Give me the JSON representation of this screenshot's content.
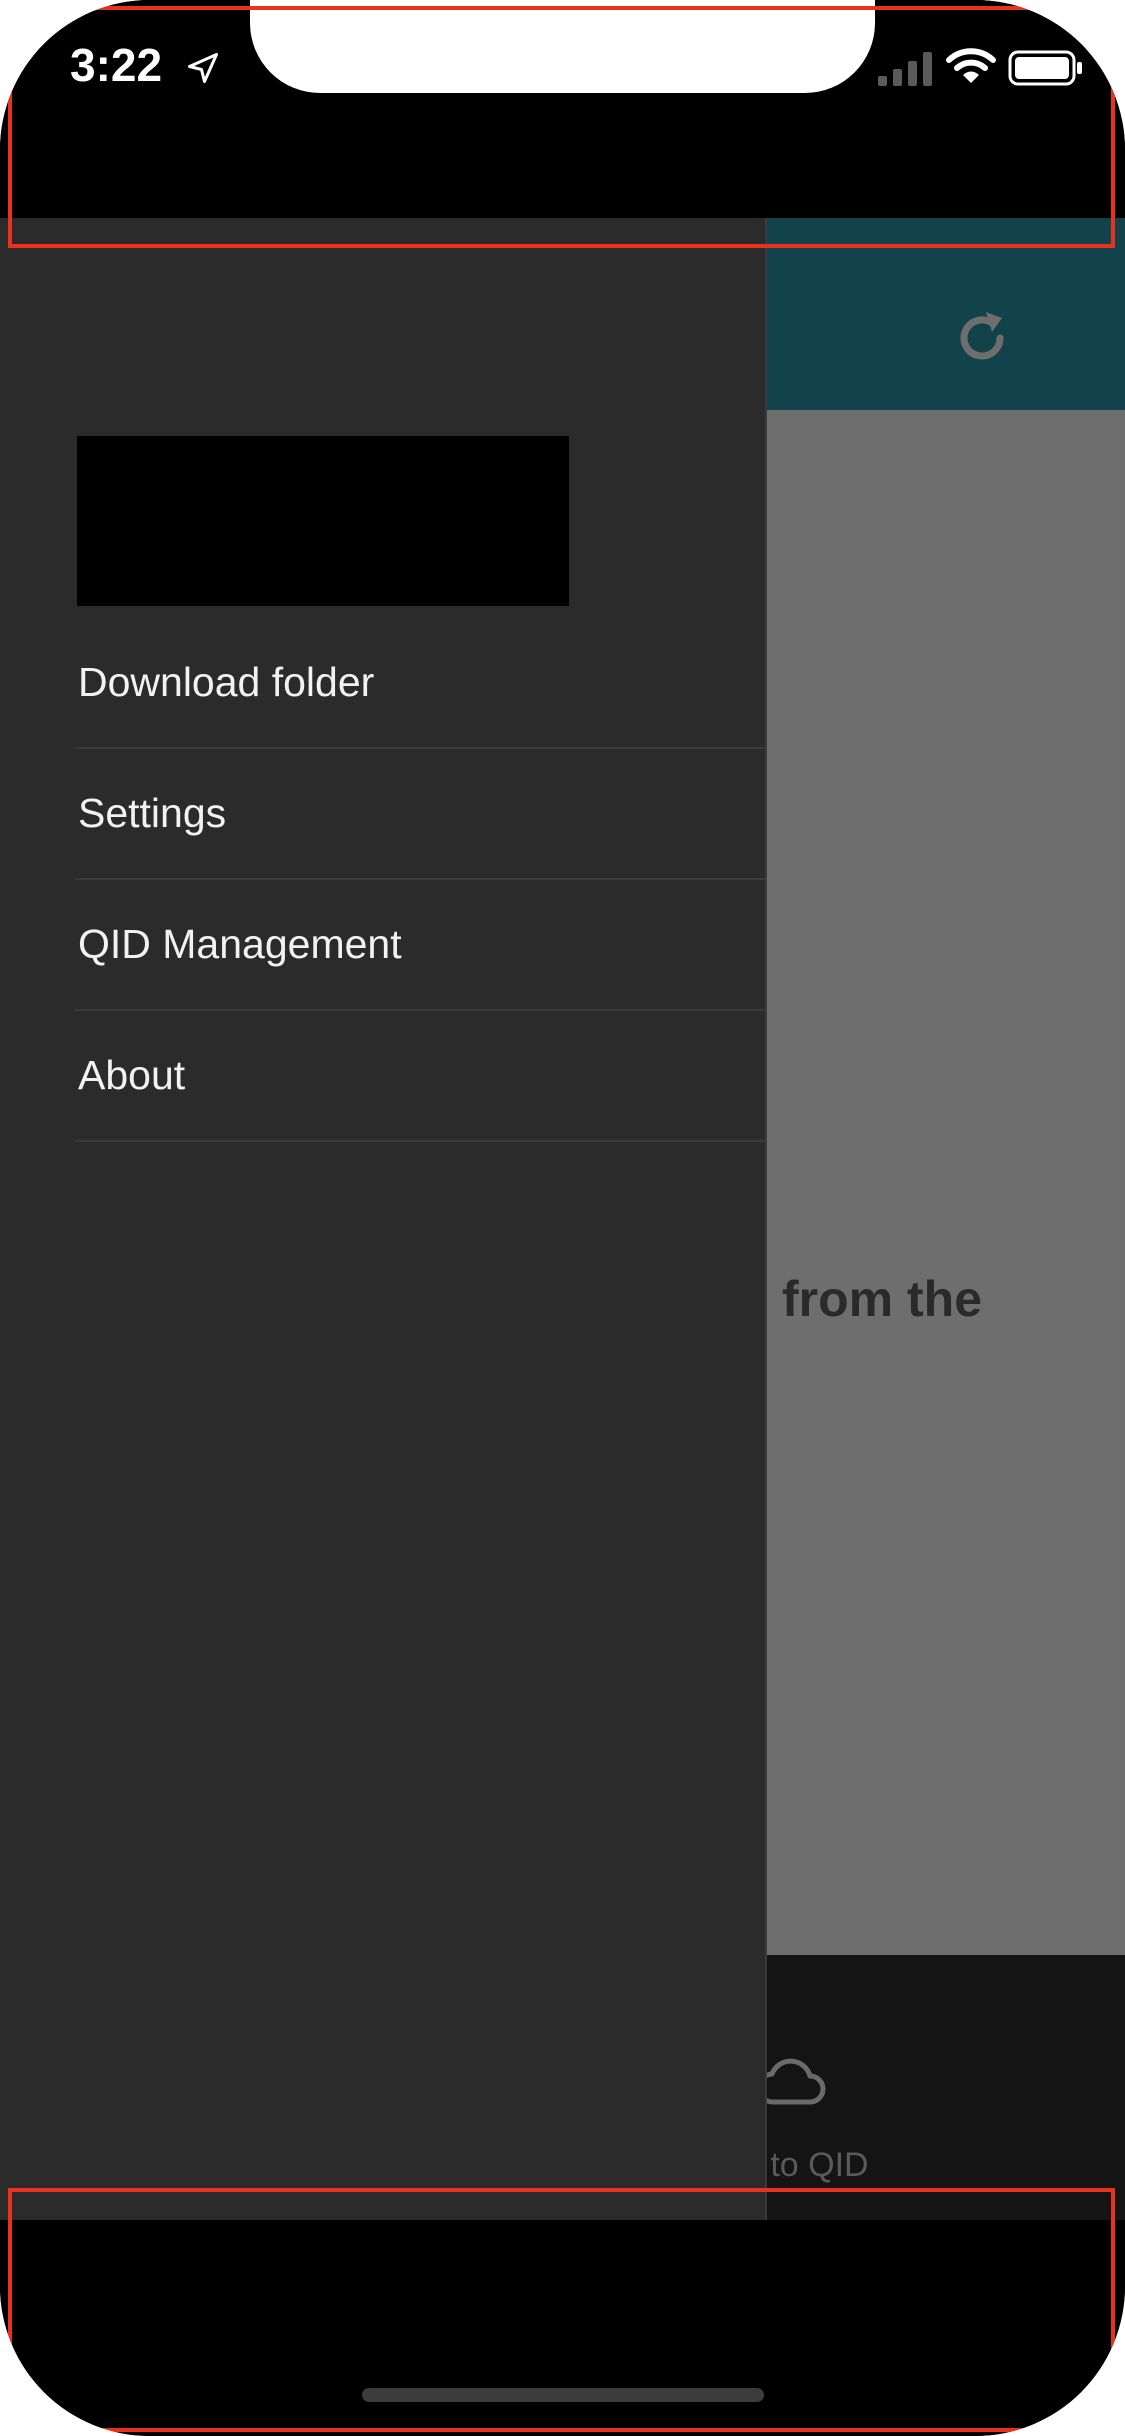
{
  "status_bar": {
    "time": "3:22",
    "icons": [
      "location-arrow-icon",
      "cellular-signal-icon",
      "wifi-icon",
      "battery-icon"
    ]
  },
  "background_app": {
    "header_icon": "refresh-icon",
    "header_color": "#12424a",
    "content_text": "from the",
    "tab_icon": "cloud-icon",
    "tab_label": "n to QID"
  },
  "drawer": {
    "logo": "redacted",
    "menu": [
      {
        "label": "Download folder"
      },
      {
        "label": "Settings"
      },
      {
        "label": "QID Management"
      },
      {
        "label": "About"
      }
    ]
  },
  "colors": {
    "drawer_bg": "#2b2b2b",
    "annotation": "#e8321e"
  }
}
